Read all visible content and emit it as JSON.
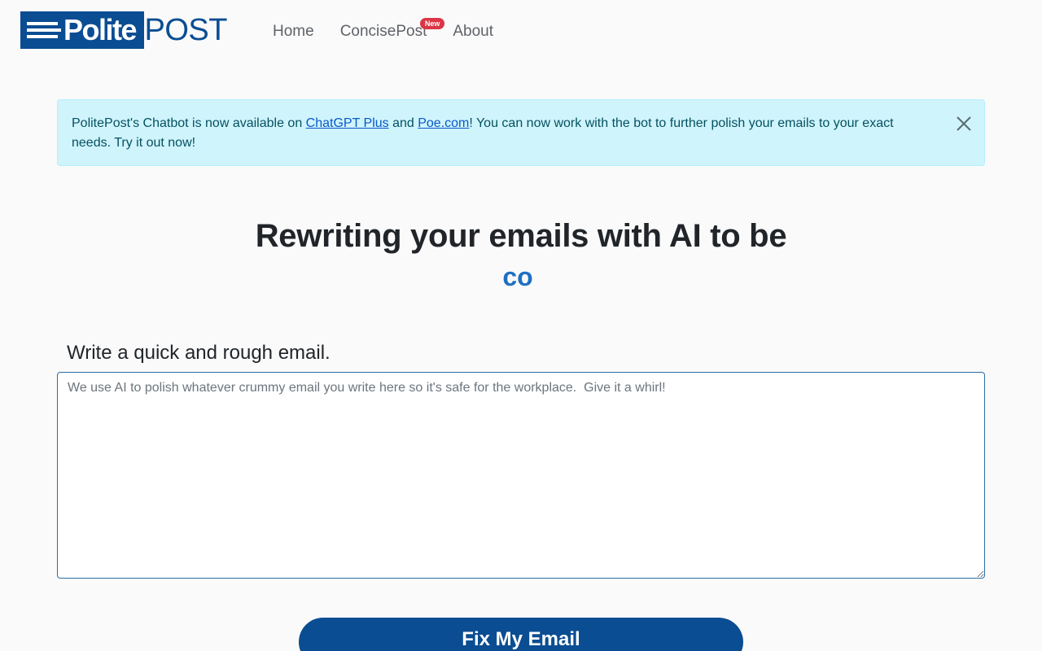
{
  "brand": {
    "name_part1": "Polite",
    "name_part2": "POST",
    "primary_color": "#0a4d92"
  },
  "nav": {
    "items": [
      {
        "label": "Home"
      },
      {
        "label": "ConcisePost",
        "badge": "New"
      },
      {
        "label": "About"
      }
    ]
  },
  "alert": {
    "text_before": "PolitePost's Chatbot is now available on ",
    "link1": "ChatGPT Plus",
    "text_middle": " and ",
    "link2": "Poe.com",
    "text_after": "! You can now work with the bot to further polish your emails to your exact needs. Try it out now!",
    "close_icon": "close-icon"
  },
  "hero": {
    "title": "Rewriting your emails with AI to be",
    "animated_word": "co",
    "accent_color": "#1e6fc4"
  },
  "form": {
    "label": "Write a quick and rough email.",
    "placeholder": "We use AI to polish whatever crummy email you write here so it's safe for the workplace.  Give it a whirl!",
    "value": "",
    "submit_label": "Fix My Email"
  }
}
